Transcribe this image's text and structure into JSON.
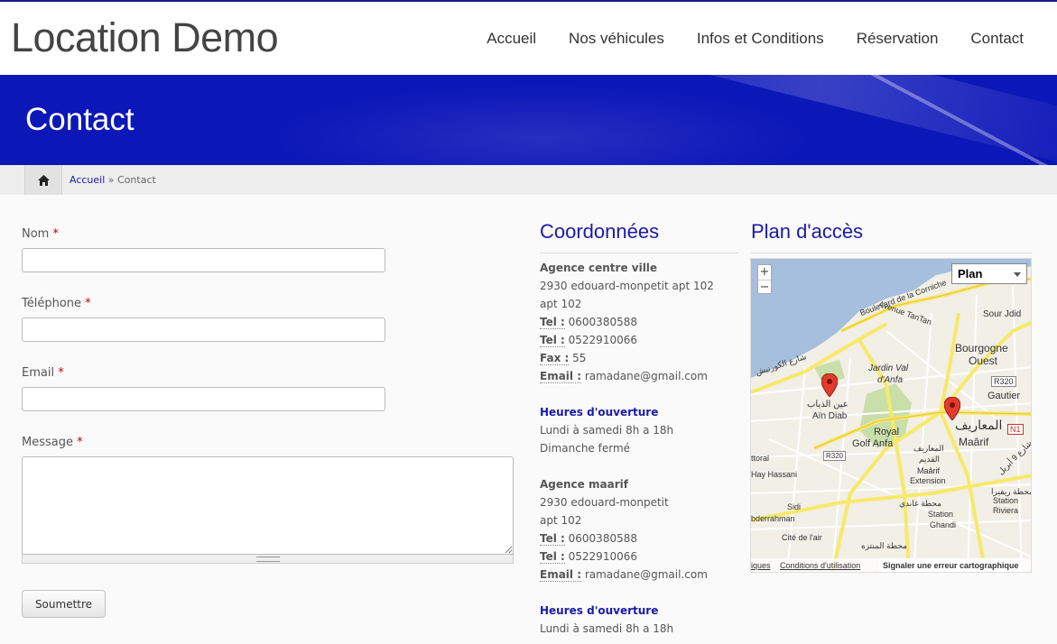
{
  "header": {
    "site_title": "Location Demo",
    "nav": [
      "Accueil",
      "Nos véhicules",
      "Infos et Conditions",
      "Réservation",
      "Contact"
    ]
  },
  "hero": {
    "title": "Contact"
  },
  "breadcrumb": {
    "home": "Accueil",
    "separator": " » ",
    "current": "Contact"
  },
  "form": {
    "required_mark": "*",
    "fields": [
      {
        "label": "Nom",
        "value": ""
      },
      {
        "label": "Téléphone",
        "value": ""
      },
      {
        "label": "Email",
        "value": ""
      },
      {
        "label": "Message",
        "value": ""
      }
    ],
    "submit_label": "Soumettre"
  },
  "coordonnees": {
    "title": "Coordonnées",
    "agencies": [
      {
        "name": "Agence centre ville",
        "address_lines": [
          "2930 edouard-monpetit apt 102",
          "apt 102"
        ],
        "contacts": [
          {
            "label": "Tel :",
            "value": " 0600380588"
          },
          {
            "label": "Tel :",
            "value": " 0522910066"
          },
          {
            "label": "Fax :",
            "value": " 55"
          },
          {
            "label": "Email :",
            "value": " ramadane@gmail.com"
          }
        ],
        "hours_title": "Heures d'ouverture",
        "hours": [
          "Lundi à samedi 8h a 18h",
          "Dimanche fermé"
        ]
      },
      {
        "name": "Agence maarif",
        "address_lines": [
          "2930 edouard-monpetit",
          "apt 102"
        ],
        "contacts": [
          {
            "label": "Tel :",
            "value": " 0600380588"
          },
          {
            "label": "Tel :",
            "value": " 0522910066"
          },
          {
            "label": "Email :",
            "value": " ramadane@gmail.com"
          }
        ],
        "hours_title": "Heures d'ouverture",
        "hours": [
          "Lundi à samedi 8h a 18h"
        ]
      }
    ]
  },
  "map_section": {
    "title": "Plan d'accès",
    "zoom_in": "+",
    "zoom_out": "−",
    "map_type": "Plan",
    "labels": {
      "boulevard": "Boulevard de la Corniche",
      "avenue": "Avenue TanTan",
      "sour_jdid": "Sour Jdid",
      "bourgogne": "Bourgogne",
      "ouest": "Ouest",
      "r320_top": "R320",
      "gautier": "Gautier",
      "jardin": "Jardin Val",
      "anfa": "d'Anfa",
      "ain_diab_ar": "عين الذياب",
      "ain_diab": "Aïn Diab",
      "royal": "Royal",
      "golf": "Golf Anfa",
      "maarif_ar": "المعاريف",
      "maarif": "Maârif",
      "n1": "N1",
      "maarif_old_ar": "المعاريف",
      "maarif_old_ar2": "القديم",
      "maarif_ext1": "Maârif",
      "maarif_ext2": "Extension",
      "ttoral": "ttoral",
      "r320_bot": "R320",
      "hay_hassani": "Hay Hassani",
      "sidi": "Sidi",
      "abderrahman": "bderrahman",
      "ghandi_ar": "محطة غاندي",
      "station": "Station",
      "ghandi": "Ghandi",
      "station_riviera_ar": "محطة ريفيرا",
      "station2": "Station",
      "riviera": "Riviera",
      "cite_air": "Cité de l'air",
      "montazah_ar": "محطة المنتزه",
      "chareh_kornich": "شارع الكورنيش",
      "chareh_anfa": "شارع 9 أبريل"
    },
    "footer": {
      "f1": "iques",
      "f2": "Conditions d'utilisation",
      "f3": "Signaler une erreur cartographique"
    },
    "colors": {
      "water": "#a5bfdd",
      "land": "#f2efe6",
      "park": "#c9dfaa",
      "major_road": "#f7e96a",
      "marker": "#e03b2e"
    }
  }
}
